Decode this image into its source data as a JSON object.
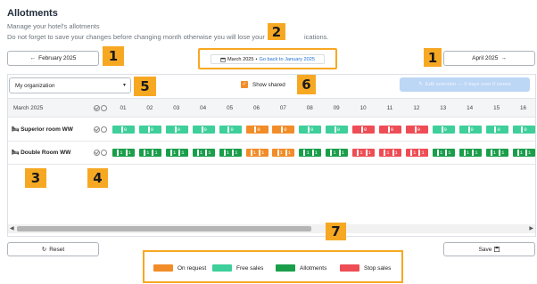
{
  "header": {
    "title": "Allotments",
    "subtitle1": "Manage your hotel's allotments",
    "subtitle2": "Do not forget to save your changes before changing month otherwise you will lose your",
    "subtitle2_tail": "ications."
  },
  "nav": {
    "prev_label": "February 2025",
    "next_label": "April 2025",
    "current_month": "March 2025",
    "separator": "•",
    "back_link": "Go back to January 2025"
  },
  "filters": {
    "organization": "My organization",
    "show_shared_label": "Show shared",
    "show_shared_checked": true,
    "edit_button": "Edit selection — 0 days over 0 rooms"
  },
  "grid": {
    "month_label": "March 2025",
    "days": [
      "01",
      "02",
      "03",
      "04",
      "05",
      "06",
      "07",
      "08",
      "09",
      "10",
      "11",
      "12",
      "13",
      "14",
      "15",
      "16"
    ],
    "rooms": [
      {
        "name": "Superior room WW",
        "cells": [
          {
            "type": "free",
            "text": "0"
          },
          {
            "type": "free",
            "text": "0"
          },
          {
            "type": "free",
            "text": "0"
          },
          {
            "type": "free",
            "text": "0"
          },
          {
            "type": "free",
            "text": "0"
          },
          {
            "type": "request",
            "text": "0"
          },
          {
            "type": "request",
            "text": "0"
          },
          {
            "type": "free",
            "text": "0"
          },
          {
            "type": "free",
            "text": "0"
          },
          {
            "type": "stop",
            "text": "0"
          },
          {
            "type": "stop",
            "text": "0"
          },
          {
            "type": "stop",
            "text": "0"
          },
          {
            "type": "free",
            "text": "0"
          },
          {
            "type": "free",
            "text": "0"
          },
          {
            "type": "free",
            "text": "0"
          },
          {
            "type": "free",
            "text": "0"
          }
        ]
      },
      {
        "name": "Double Room WW",
        "cells": [
          {
            "type": "allot",
            "text": "1 1"
          },
          {
            "type": "allot",
            "text": "1 1"
          },
          {
            "type": "allot",
            "text": "1 1"
          },
          {
            "type": "allot",
            "text": "1 1"
          },
          {
            "type": "allot",
            "text": "1 1"
          },
          {
            "type": "request",
            "text": "1 1"
          },
          {
            "type": "request",
            "text": "1 1"
          },
          {
            "type": "allot",
            "text": "1 1"
          },
          {
            "type": "allot",
            "text": "1 1"
          },
          {
            "type": "stop",
            "text": "1 1"
          },
          {
            "type": "stop",
            "text": "1 1"
          },
          {
            "type": "stop",
            "text": "1 1"
          },
          {
            "type": "allot",
            "text": "1 1"
          },
          {
            "type": "allot",
            "text": "1 1"
          },
          {
            "type": "allot",
            "text": "1 1"
          },
          {
            "type": "allot",
            "text": "1 1"
          }
        ]
      }
    ]
  },
  "actions": {
    "reset_label": "Reset",
    "save_label": "Save"
  },
  "legend": [
    {
      "label": "On request",
      "color": "#f28c28"
    },
    {
      "label": "Free sales",
      "color": "#3ecf9a"
    },
    {
      "label": "Allotments",
      "color": "#1a9e4a"
    },
    {
      "label": "Stop sales",
      "color": "#ee4d55"
    }
  ],
  "annotations": {
    "b1": "1",
    "b2": "2",
    "b3": "3",
    "b4": "4",
    "b5": "5",
    "b6": "6",
    "b7": "7"
  },
  "colors": {
    "request": "#f28c28",
    "free": "#3ecf9a",
    "allot": "#1a9e4a",
    "stop": "#ee4d55",
    "highlight": "#f7a823"
  },
  "icons": {
    "prev": "arrow-left-icon",
    "next": "arrow-right-icon",
    "calendar": "calendar-icon",
    "reset": "refresh-icon",
    "save": "save-icon",
    "bed": "bed-icon",
    "edit": "pencil-icon"
  }
}
